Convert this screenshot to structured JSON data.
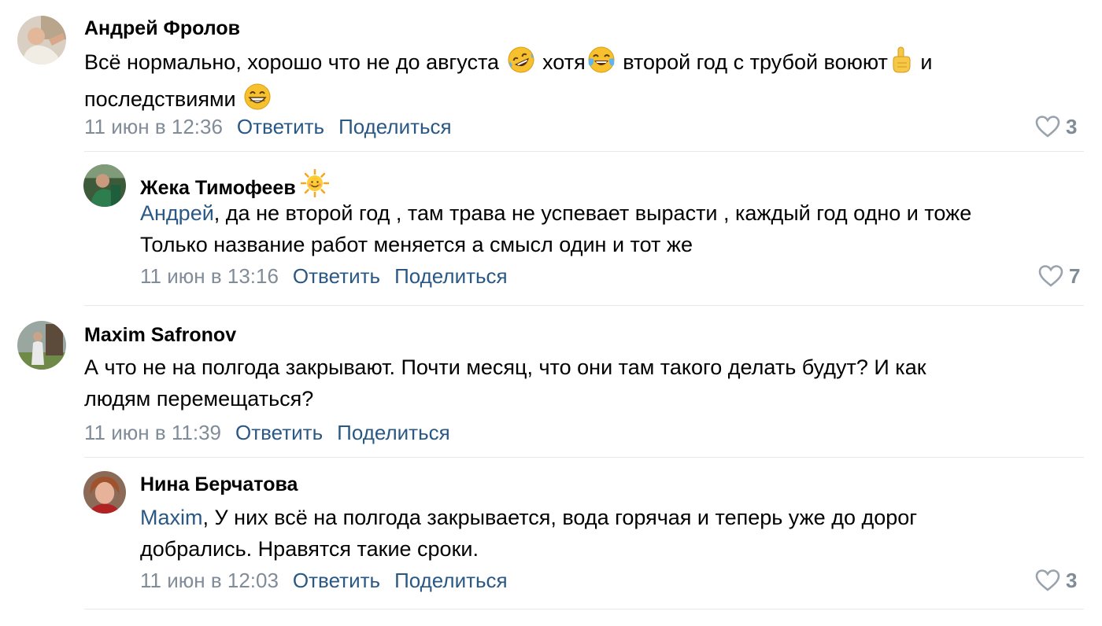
{
  "comments": [
    {
      "author": "Андрей Фролов",
      "text_1": "Всё нормально, хорошо что не до августа",
      "text_2": "хотя",
      "text_3": "второй год с трубой воюют",
      "text_4": "и",
      "text_5": "последствиями",
      "date": "11 июн в 12:36",
      "reply": "Ответить",
      "share": "Поделиться",
      "likes": "3",
      "icons": [
        "rofl-emoji",
        "tears-of-joy-emoji",
        "index-pointing-up-emoji",
        "grinning-emoji",
        "heart-icon"
      ]
    },
    {
      "author": "Жека Тимофеев",
      "mention": "Андрей",
      "text_1": ", да не второй год , там трава не успевает вырасти , каждый год одно и тоже",
      "text_2": "Только название работ меняется а смысл один и тот же",
      "date": "11 июн в 13:16",
      "reply": "Ответить",
      "share": "Поделиться",
      "likes": "7",
      "icons": [
        "sun-emoji",
        "heart-icon"
      ]
    },
    {
      "author": "Maxim Safronov",
      "text_1": "А что не на полгода закрывают. Почти месяц, что они там такого делать будут? И как",
      "text_2": "людям перемещаться?",
      "date": "11 июн в 11:39",
      "reply": "Ответить",
      "share": "Поделиться"
    },
    {
      "author": "Нина Берчатова",
      "mention": "Maxim",
      "text_1": ", У них всё на полгода закрывается, вода горячая и теперь уже до дорог",
      "text_2": "добрались. Нравятся такие сроки.",
      "date": "11 июн в 12:03",
      "reply": "Ответить",
      "share": "Поделиться",
      "likes": "3",
      "icons": [
        "heart-icon"
      ]
    }
  ],
  "colors": {
    "link": "#2a5885",
    "secondary": "#818c99",
    "divider": "#e7e8ec"
  }
}
